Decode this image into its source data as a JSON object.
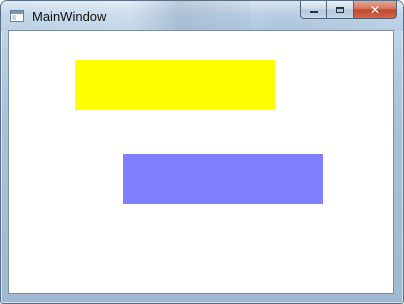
{
  "window": {
    "title": "MainWindow",
    "icon": "app-window-icon",
    "controls": {
      "minimize_icon": "minimize-icon",
      "maximize_icon": "maximize-icon",
      "close_icon": "close-icon",
      "close_glyph": "✕"
    }
  },
  "canvas": {
    "background": "#ffffff",
    "shapes": [
      {
        "name": "yellow-rectangle",
        "color": "#ffff00"
      },
      {
        "name": "blue-rectangle",
        "color": "#8080ff"
      }
    ]
  }
}
